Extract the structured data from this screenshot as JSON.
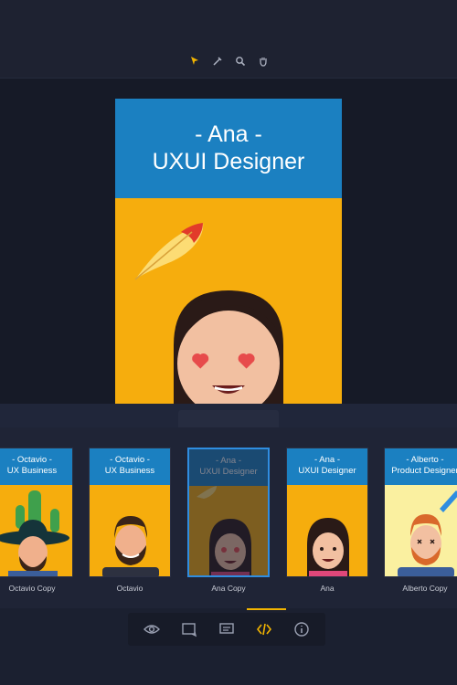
{
  "toolbar": {
    "tools": [
      {
        "icon": "cursor-arrow-icon",
        "active": true
      },
      {
        "icon": "eyedropper-icon",
        "active": false
      },
      {
        "icon": "zoom-icon",
        "active": false
      },
      {
        "icon": "hand-icon",
        "active": false
      }
    ]
  },
  "artboard": {
    "title_line1": "- Ana -",
    "title_line2": "UXUI Designer",
    "header_color": "#1b80c1",
    "background_color": "#f6ad0d"
  },
  "cards": [
    {
      "line1": "- Octavio -",
      "line2": "UX Business",
      "caption": "Octavio Copy",
      "avatar": "octavio-sombrero",
      "bg": "#f6ad0d"
    },
    {
      "line1": "- Octavio -",
      "line2": "UX Business",
      "caption": "Octavio",
      "avatar": "octavio",
      "bg": "#f6ad0d"
    },
    {
      "line1": "- Ana -",
      "line2": "UXUI Designer",
      "caption": "Ana Copy",
      "avatar": "ana-hearts",
      "bg": "#f6ad0d",
      "selected": true
    },
    {
      "line1": "- Ana -",
      "line2": "UXUI Designer",
      "caption": "Ana",
      "avatar": "ana",
      "bg": "#f6ad0d"
    },
    {
      "line1": "- Alberto -",
      "line2": "Product Designer",
      "caption": "Alberto Copy",
      "avatar": "alberto",
      "bg": "#faf0a0"
    }
  ],
  "bottom_toolbar": {
    "buttons": [
      {
        "icon": "eye-icon",
        "active": false
      },
      {
        "icon": "artboard-icon",
        "active": false
      },
      {
        "icon": "comment-icon",
        "active": false
      },
      {
        "icon": "code-icon",
        "active": true
      },
      {
        "icon": "info-icon",
        "active": false
      }
    ],
    "accent": "#f2b400"
  }
}
